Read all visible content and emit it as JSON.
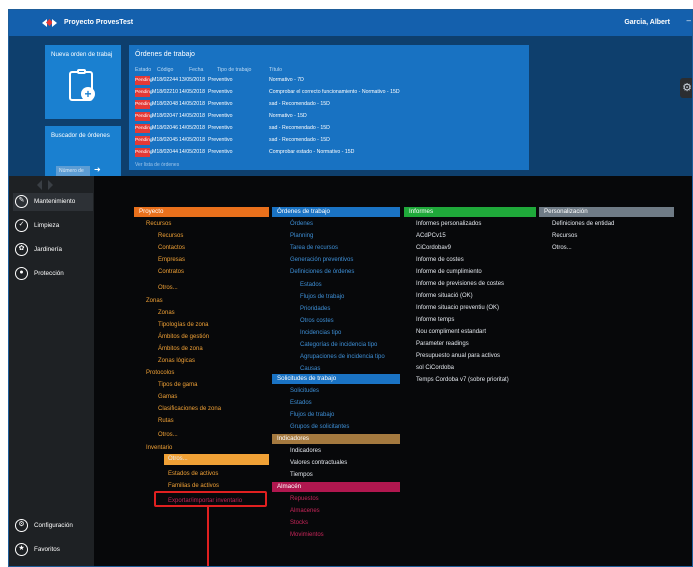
{
  "window": {
    "app_title": "Proyecto ProvesTest",
    "user": "Garcia, Albert",
    "controls": "–"
  },
  "tiles": {
    "new_order": "Nueva orden de trabaj",
    "search_orders": "Buscador de órdenes",
    "search_combo": "Número de",
    "search_go": "➜"
  },
  "orders": {
    "title": "Órdenes de trabajo",
    "headers": [
      "Estado",
      "Código",
      "Fecha",
      "Tipo de trabajo",
      "Título"
    ],
    "rows": [
      {
        "status": "Pending",
        "code": "M18/02244",
        "date": "13/05/2018",
        "type": "Preventivo",
        "title": "Normativo - 7D"
      },
      {
        "status": "Pending",
        "code": "M18/02210",
        "date": "14/05/2018",
        "type": "Preventivo",
        "title": "Comprobar el correcto funcionamiento - Normativo - 15D"
      },
      {
        "status": "Pending",
        "code": "M18/02048",
        "date": "14/05/2018",
        "type": "Preventivo",
        "title": "sad - Recomendado - 15D"
      },
      {
        "status": "Pending",
        "code": "M18/02047",
        "date": "14/05/2018",
        "type": "Preventivo",
        "title": "Normativo - 15D"
      },
      {
        "status": "Pending",
        "code": "M18/02046",
        "date": "14/05/2018",
        "type": "Preventivo",
        "title": "sad - Recomendado - 15D"
      },
      {
        "status": "Pending",
        "code": "M18/02045",
        "date": "14/05/2018",
        "type": "Preventivo",
        "title": "sad - Recomendado - 15D"
      },
      {
        "status": "Pending",
        "code": "M18/02044",
        "date": "14/05/2018",
        "type": "Preventivo",
        "title": "Comprobar estado - Normativo - 15D"
      }
    ],
    "more": "Ver lista de órdenes"
  },
  "sidebar": {
    "items": [
      "Mantenimiento",
      "Limpieza",
      "Jardinería",
      "Protección"
    ],
    "bottom": [
      "Configuración",
      "Favoritos"
    ]
  },
  "menu": {
    "proyecto": {
      "title": "Proyecto",
      "items": [
        "Recursos",
        "Recursos",
        "Contactos",
        "Empresas",
        "Contratos",
        "Otros...",
        "Zonas",
        "Zonas",
        "Tipologías de zona",
        "Ámbitos de gestión",
        "Ámbitos de zona",
        "Zonas lógicas",
        "Protocolos",
        "Tipos de gama",
        "Gamas",
        "Clasificaciones de zona",
        "Rutas",
        "Otros...",
        "Inventario",
        "Otros...",
        "Estados de activos",
        "Familias de activos",
        "Exportar/importar inventario"
      ]
    },
    "ordenes": {
      "title": "Órdenes de trabajo",
      "items": [
        "Órdenes",
        "Planning",
        "Tarea de recursos",
        "Generación preventivos",
        "Definiciones de órdenes",
        "Estados",
        "Flujos de trabajo",
        "Prioridades",
        "Otros costes",
        "Incidencias tipo",
        "Categorías de incidencia tipo",
        "Agrupaciones de incidencia tipo",
        "Causas"
      ]
    },
    "solicitudes": {
      "title": "Solicitudes de trabajo",
      "items": [
        "Solicitudes",
        "Estados",
        "Flujos de trabajo",
        "Grupos de solicitantes"
      ]
    },
    "indicadores": {
      "title": "Indicadores",
      "items": [
        "Indicadores",
        "Valores contractuales",
        "Tiempos"
      ]
    },
    "almacen": {
      "title": "Almacén",
      "items": [
        "Repuestos",
        "Almacenes",
        "Stocks",
        "Movimientos"
      ]
    },
    "informes": {
      "title": "Informes",
      "items": [
        "Informes personalizados",
        "ACdPCv15",
        "CiCordobav9",
        "Informe de costes",
        "Informe de cumplimiento",
        "Informe de previsiones de costes",
        "Informe situació (OK)",
        "Informe situacio preventiu (OK)",
        "Informe temps",
        "Nou compliment estandart",
        "Parameter readings",
        "Presupuesto anual para activos",
        "sol CiCordoba",
        "Temps Cordoba v7 (sobre prioritat)"
      ]
    },
    "personalizacion": {
      "title": "Personalización",
      "items": [
        "Definiciones de entidad",
        "Recursos",
        "Otros..."
      ]
    }
  },
  "colors": {
    "proyecto": "#e9701c",
    "ordenes": "#1a73c4",
    "informes": "#1fa93a",
    "personalizacion": "#6f7b86",
    "solicitudes": "#1a73c4",
    "indicadores": "#a4793f",
    "almacen": "#b0174f",
    "highlight": "#e02020"
  }
}
